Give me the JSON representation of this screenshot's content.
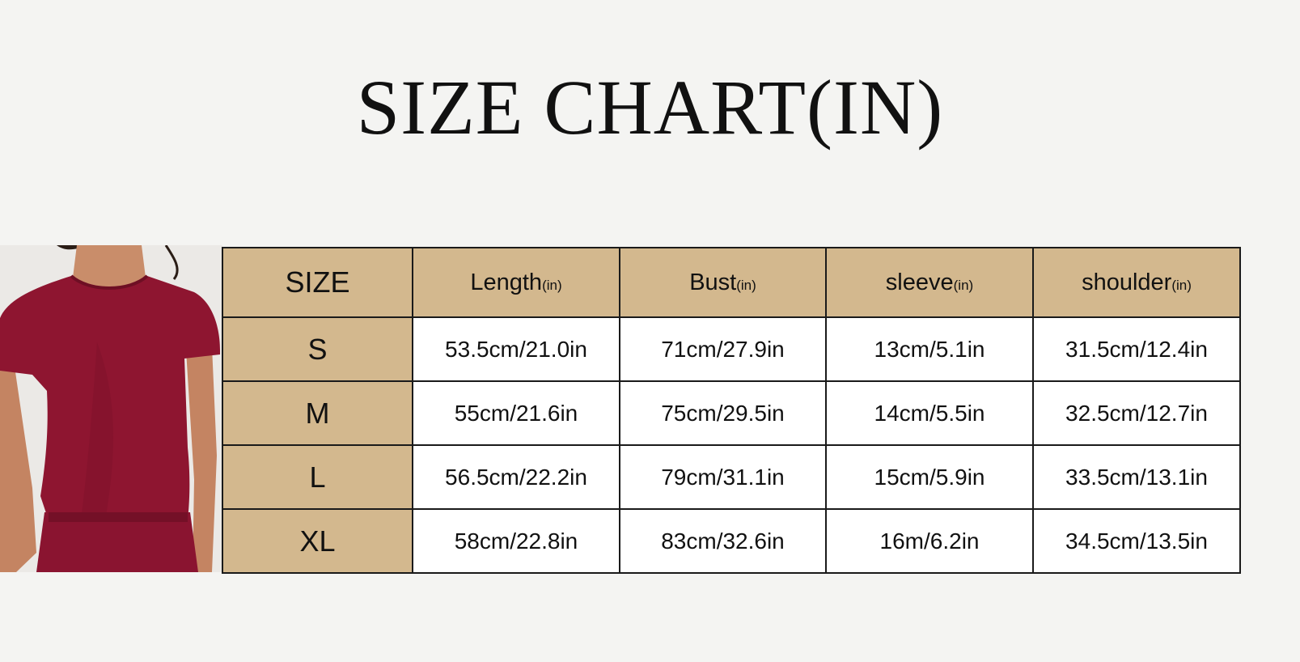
{
  "title": "SIZE CHART(IN)",
  "colors": {
    "header_bg": "#d3b88e",
    "cell_bg": "#ffffff",
    "page_bg": "#f4f4f2",
    "garment": "#8e1530"
  },
  "product_image": {
    "description_icon": "model-wearing-burgundy-tshirt"
  },
  "table": {
    "columns": [
      {
        "label": "SIZE",
        "unit": ""
      },
      {
        "label": "Length",
        "unit": "(in)"
      },
      {
        "label": "Bust",
        "unit": "(in)"
      },
      {
        "label": "sleeve",
        "unit": "(in)"
      },
      {
        "label": "shoulder",
        "unit": "(in)"
      }
    ],
    "rows": [
      {
        "size": "S",
        "length": "53.5cm/21.0in",
        "bust": "71cm/27.9in",
        "sleeve": "13cm/5.1in",
        "shoulder": "31.5cm/12.4in"
      },
      {
        "size": "M",
        "length": "55cm/21.6in",
        "bust": "75cm/29.5in",
        "sleeve": "14cm/5.5in",
        "shoulder": "32.5cm/12.7in"
      },
      {
        "size": "L",
        "length": "56.5cm/22.2in",
        "bust": "79cm/31.1in",
        "sleeve": "15cm/5.9in",
        "shoulder": "33.5cm/13.1in"
      },
      {
        "size": "XL",
        "length": "58cm/22.8in",
        "bust": "83cm/32.6in",
        "sleeve": "16m/6.2in",
        "shoulder": "34.5cm/13.5in"
      }
    ]
  }
}
